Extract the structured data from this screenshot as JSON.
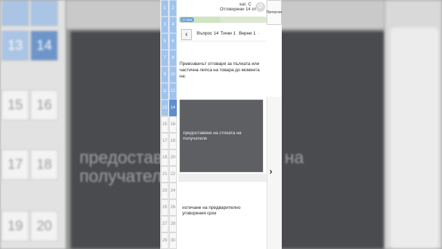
{
  "header": {
    "category": "кат. C",
    "answered": "Отговорени 14 от 30",
    "skip": "Пропусни",
    "gear_icon": "gear-icon"
  },
  "progress": {
    "value": 0.47,
    "timer": "17 мин"
  },
  "nav": {
    "question": "Въпрос 14",
    "points": "Точки 1",
    "correct": "Верни 1",
    "more": "·"
  },
  "question_text": "Превозвачът отговаря за пълната или частична липса на товара до момента на:",
  "options": [
    "предоставяне на стоката на получателя",
    "изтичане на предварително уговорения срок"
  ],
  "question_numbers": [
    "1",
    "2",
    "3",
    "4",
    "5",
    "6",
    "7",
    "8",
    "9",
    "10",
    "11",
    "12",
    "13",
    "14",
    "15",
    "16",
    "17",
    "18",
    "19",
    "20",
    "21",
    "22",
    "23",
    "24",
    "25",
    "26",
    "27",
    "28",
    "29",
    "30"
  ],
  "current_question": 14,
  "background": {
    "numbers": [
      "13",
      "14",
      "15",
      "16",
      "17",
      "18",
      "19",
      "20"
    ],
    "dark_text_line1": "предоставяне на стоката на",
    "dark_text_line2": "получателя"
  }
}
